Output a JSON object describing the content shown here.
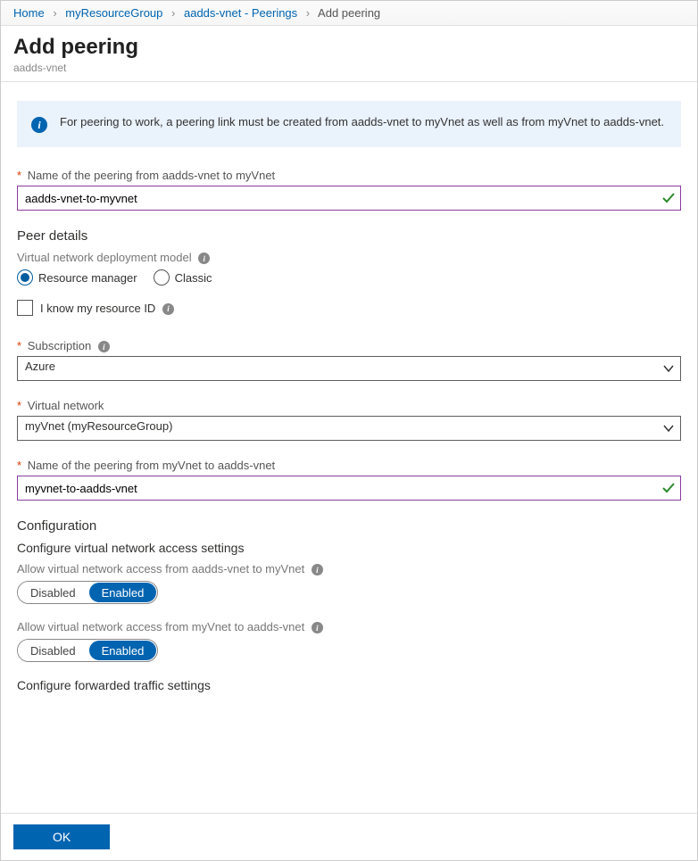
{
  "breadcrumb": {
    "items": [
      "Home",
      "myResourceGroup",
      "aadds-vnet - Peerings",
      "Add peering"
    ]
  },
  "header": {
    "title": "Add peering",
    "subtitle": "aadds-vnet"
  },
  "info": {
    "text": "For peering to work, a peering link must be created from aadds-vnet to myVnet as well as from myVnet to aadds-vnet."
  },
  "fields": {
    "peering_name_1": {
      "label": "Name of the peering from aadds-vnet to myVnet",
      "value": "aadds-vnet-to-myvnet"
    },
    "peer_details_title": "Peer details",
    "deployment_model": {
      "label": "Virtual network deployment model",
      "option_rm": "Resource manager",
      "option_classic": "Classic"
    },
    "know_id": {
      "label": "I know my resource ID"
    },
    "subscription": {
      "label": "Subscription",
      "value": "Azure"
    },
    "vnet": {
      "label": "Virtual network",
      "value": "myVnet (myResourceGroup)"
    },
    "peering_name_2": {
      "label": "Name of the peering from myVnet to aadds-vnet",
      "value": "myvnet-to-aadds-vnet"
    },
    "config_title": "Configuration",
    "access_title": "Configure virtual network access settings",
    "access_1_label": "Allow virtual network access from aadds-vnet to myVnet",
    "access_2_label": "Allow virtual network access from myVnet to aadds-vnet",
    "toggle": {
      "disabled": "Disabled",
      "enabled": "Enabled"
    },
    "forwarded_title": "Configure forwarded traffic settings"
  },
  "footer": {
    "ok": "OK"
  }
}
